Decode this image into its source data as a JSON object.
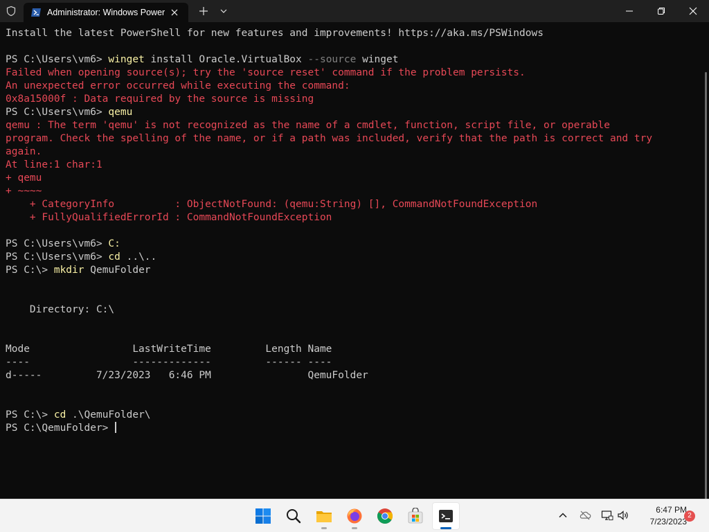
{
  "window": {
    "tab_title": "Administrator: Windows PowerShell",
    "buttons": {
      "minimize": "minimize",
      "maximize": "restore",
      "close": "close"
    }
  },
  "terminal": {
    "lines": [
      {
        "segments": [
          {
            "t": "Install the latest PowerShell for new features and improvements! https://aka.ms/PSWindows",
            "c": "out"
          }
        ]
      },
      {
        "segments": []
      },
      {
        "segments": [
          {
            "t": "PS C:\\Users\\vm6> ",
            "c": "out"
          },
          {
            "t": "winget",
            "c": "cmd"
          },
          {
            "t": " install Oracle.VirtualBox ",
            "c": "out"
          },
          {
            "t": "--source",
            "c": "param"
          },
          {
            "t": " winget",
            "c": "out"
          }
        ]
      },
      {
        "segments": [
          {
            "t": "Failed when opening source(s); try the 'source reset' command if the problem persists.",
            "c": "err"
          }
        ]
      },
      {
        "segments": [
          {
            "t": "An unexpected error occurred while executing the command:",
            "c": "err"
          }
        ]
      },
      {
        "segments": [
          {
            "t": "0x8a15000f : Data required by the source is missing",
            "c": "err"
          }
        ]
      },
      {
        "segments": [
          {
            "t": "PS C:\\Users\\vm6> ",
            "c": "out"
          },
          {
            "t": "qemu",
            "c": "cmd"
          }
        ]
      },
      {
        "segments": [
          {
            "t": "qemu : The term 'qemu' is not recognized as the name of a cmdlet, function, script file, or operable",
            "c": "err"
          }
        ]
      },
      {
        "segments": [
          {
            "t": "program. Check the spelling of the name, or if a path was included, verify that the path is correct and try",
            "c": "err"
          }
        ]
      },
      {
        "segments": [
          {
            "t": "again.",
            "c": "err"
          }
        ]
      },
      {
        "segments": [
          {
            "t": "At line:1 char:1",
            "c": "err"
          }
        ]
      },
      {
        "segments": [
          {
            "t": "+ qemu",
            "c": "err"
          }
        ]
      },
      {
        "segments": [
          {
            "t": "+ ~~~~",
            "c": "err"
          }
        ]
      },
      {
        "segments": [
          {
            "t": "    + CategoryInfo          : ObjectNotFound: (qemu:String) [], CommandNotFoundException",
            "c": "err"
          }
        ]
      },
      {
        "segments": [
          {
            "t": "    + FullyQualifiedErrorId : CommandNotFoundException",
            "c": "err"
          }
        ]
      },
      {
        "segments": []
      },
      {
        "segments": [
          {
            "t": "PS C:\\Users\\vm6> ",
            "c": "out"
          },
          {
            "t": "C:",
            "c": "cmd"
          }
        ]
      },
      {
        "segments": [
          {
            "t": "PS C:\\Users\\vm6> ",
            "c": "out"
          },
          {
            "t": "cd",
            "c": "cmd"
          },
          {
            "t": " ..\\..",
            "c": "out"
          }
        ]
      },
      {
        "segments": [
          {
            "t": "PS C:\\> ",
            "c": "out"
          },
          {
            "t": "mkdir",
            "c": "cmd"
          },
          {
            "t": " QemuFolder",
            "c": "out"
          }
        ]
      },
      {
        "segments": []
      },
      {
        "segments": []
      },
      {
        "segments": [
          {
            "t": "    Directory: C:\\",
            "c": "out"
          }
        ]
      },
      {
        "segments": []
      },
      {
        "segments": []
      },
      {
        "segments": [
          {
            "t": "Mode                 LastWriteTime         Length Name",
            "c": "out"
          }
        ]
      },
      {
        "segments": [
          {
            "t": "----                 -------------         ------ ----",
            "c": "out"
          }
        ]
      },
      {
        "segments": [
          {
            "t": "d-----         7/23/2023   6:46 PM                QemuFolder",
            "c": "out"
          }
        ]
      },
      {
        "segments": []
      },
      {
        "segments": []
      },
      {
        "segments": [
          {
            "t": "PS C:\\> ",
            "c": "out"
          },
          {
            "t": "cd",
            "c": "cmd"
          },
          {
            "t": " .\\QemuFolder\\",
            "c": "out"
          }
        ]
      },
      {
        "segments": [
          {
            "t": "PS C:\\QemuFolder> ",
            "c": "out"
          }
        ],
        "cursor": true
      }
    ]
  },
  "taskbar": {
    "apps": [
      "start-icon",
      "search-icon",
      "file-explorer-icon",
      "firefox-icon",
      "chrome-icon",
      "microsoft-store-icon",
      "terminal-icon"
    ],
    "tray": [
      "chevron-up-icon",
      "onedrive-icon",
      "network-icon",
      "volume-icon"
    ],
    "time": "6:47 PM",
    "date": "7/23/2023",
    "notification_count": "2"
  },
  "colors": {
    "terminal_bg": "#0c0c0c",
    "terminal_fg": "#cccccc",
    "error": "#e74856",
    "command": "#f9f1a5",
    "parameter": "#808080",
    "taskbar_bg": "#f3f3f3",
    "accent": "#005fb8"
  }
}
